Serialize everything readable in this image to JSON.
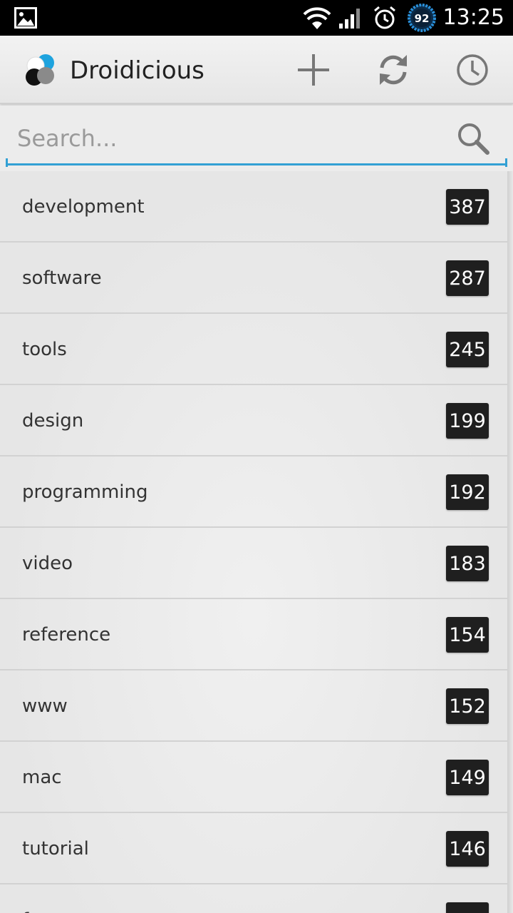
{
  "status_bar": {
    "time": "13:25",
    "battery_level": "92",
    "icons": [
      "picture-notification-icon",
      "wifi-icon",
      "signal-icon",
      "alarm-icon",
      "battery-icon"
    ]
  },
  "action_bar": {
    "title": "Droidicious",
    "actions": [
      "add-icon",
      "refresh-icon",
      "clock-icon"
    ]
  },
  "search": {
    "placeholder": "Search...",
    "value": ""
  },
  "tags": [
    {
      "name": "development",
      "count": "387"
    },
    {
      "name": "software",
      "count": "287"
    },
    {
      "name": "tools",
      "count": "245"
    },
    {
      "name": "design",
      "count": "199"
    },
    {
      "name": "programming",
      "count": "192"
    },
    {
      "name": "video",
      "count": "183"
    },
    {
      "name": "reference",
      "count": "154"
    },
    {
      "name": "www",
      "count": "152"
    },
    {
      "name": "mac",
      "count": "149"
    },
    {
      "name": "tutorial",
      "count": "146"
    },
    {
      "name": "f",
      "count": ""
    }
  ],
  "colors": {
    "accent": "#33a0d4",
    "badge_bg": "#1f1f1f",
    "status_bg": "#000000"
  }
}
